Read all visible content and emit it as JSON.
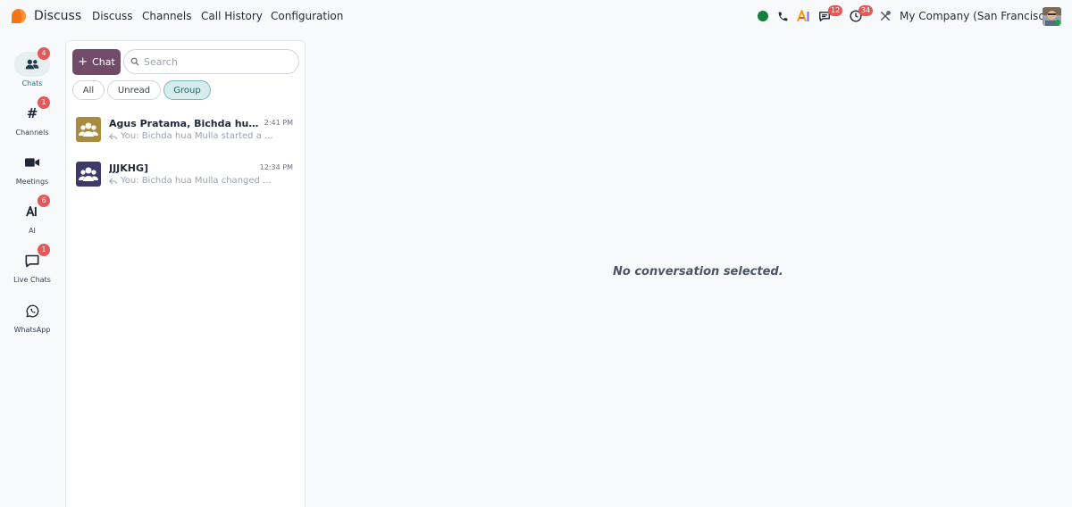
{
  "app": {
    "title": "Discuss",
    "brand_color": "#f97316"
  },
  "topnav": [
    {
      "label": "Discuss"
    },
    {
      "label": "Channels"
    },
    {
      "label": "Call History"
    },
    {
      "label": "Configuration"
    }
  ],
  "systray": {
    "status_color": "#15803d",
    "messages_badge": "12",
    "activities_badge": "34",
    "company": "My Company (San Francisco)"
  },
  "sidebar": [
    {
      "label": "Chats",
      "icon": "users-icon",
      "badge": "4",
      "active": true
    },
    {
      "label": "Channels",
      "icon": "hash-icon",
      "badge": "1"
    },
    {
      "label": "Meetings",
      "icon": "video-icon",
      "badge": ""
    },
    {
      "label": "AI",
      "icon": "ai-icon",
      "badge": "6"
    },
    {
      "label": "Live Chats",
      "icon": "chat-bubble-icon",
      "badge": "1"
    },
    {
      "label": "WhatsApp",
      "icon": "whatsapp-icon",
      "badge": ""
    }
  ],
  "chat_panel": {
    "new_chat_label": "Chat",
    "search_placeholder": "Search",
    "filters": [
      {
        "label": "All"
      },
      {
        "label": "Unread"
      },
      {
        "label": "Group",
        "active": true
      }
    ],
    "conversations": [
      {
        "name": "Agus Pratama, Bichda hua M...",
        "time": "2:41 PM",
        "last_message": "You: Bichda hua Mulla started a ...",
        "avatar_color": "#a98a3f"
      },
      {
        "name": "JJJKHG]",
        "time": "12:34 PM",
        "last_message": "You: Bichda hua Mulla changed ...",
        "avatar_color": "#3d3a6b"
      }
    ]
  },
  "main": {
    "empty_text": "No conversation selected."
  }
}
